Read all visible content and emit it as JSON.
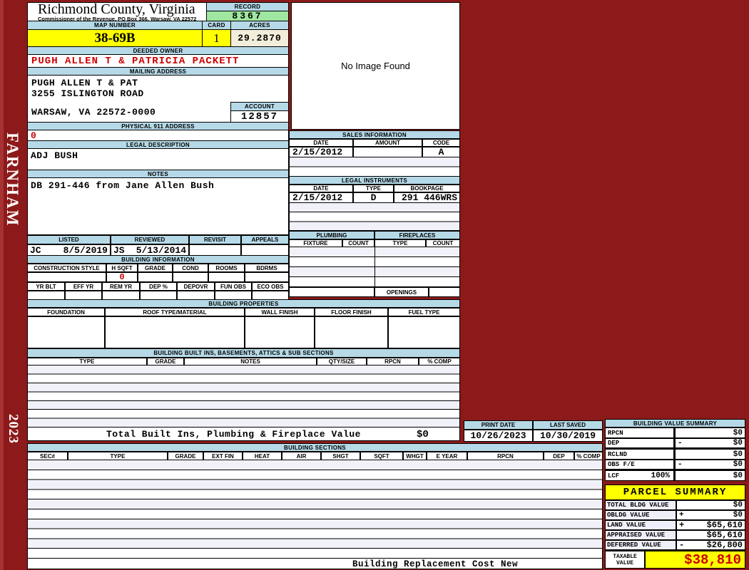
{
  "sidebar": {
    "district": "FARNHAM",
    "year": "2023"
  },
  "header": {
    "county_title": "Richmond County, Virginia",
    "county_subtitle": "Commissioner of the Revenue, PO Box 366, Warsaw, VA 22572",
    "record_label": "RECORD",
    "record_value": "8367",
    "map_label": "MAP NUMBER",
    "map_value": "38-69B",
    "card_label": "CARD",
    "card_value": "1",
    "acres_label": "ACRES",
    "acres_value": "29.2870"
  },
  "owner": {
    "label": "DEEDED OWNER",
    "value": "PUGH ALLEN T & PATRICIA PACKETT"
  },
  "mailing": {
    "label": "MAILING ADDRESS",
    "line1": "PUGH ALLEN T & PAT",
    "line2": "3255 ISLINGTON ROAD",
    "line3": "WARSAW, VA 22572-0000"
  },
  "account": {
    "label": "ACCOUNT",
    "value": "12857"
  },
  "physical_911": {
    "label": "PHYSICAL 911 ADDRESS",
    "value": "0"
  },
  "legal_description": {
    "label": "LEGAL DESCRIPTION",
    "value": "ADJ BUSH"
  },
  "notes": {
    "label": "NOTES",
    "value": "DB 291-446 from Jane Allen Bush"
  },
  "image_box": {
    "text": "No Image Found"
  },
  "review": {
    "listed_label": "LISTED",
    "reviewed_label": "REVIEWED",
    "revisit_label": "REVISIT",
    "appeals_label": "APPEALS",
    "listed_by": "JC",
    "listed_date": "8/5/2019",
    "reviewed_by": "JS",
    "reviewed_date": "5/13/2014"
  },
  "sales": {
    "title": "SALES INFORMATION",
    "col_date": "DATE",
    "col_amount": "AMOUNT",
    "col_code": "CODE",
    "row1": {
      "date": "2/15/2012",
      "amount": "",
      "code": "A"
    }
  },
  "instruments": {
    "title": "LEGAL INSTRUMENTS",
    "col_date": "DATE",
    "col_type": "TYPE",
    "col_bookpage": "BOOKPAGE",
    "row1": {
      "date": "2/15/2012",
      "type": "D",
      "bookpage": "291 446WRS"
    }
  },
  "plumbing": {
    "title": "PLUMBING",
    "col_fixture": "FIXTURE",
    "col_count": "COUNT"
  },
  "fireplaces": {
    "title": "FIREPLACES",
    "col_type": "TYPE",
    "col_count": "COUNT",
    "openings_label": "OPENINGS"
  },
  "building_info": {
    "title": "BUILDING INFORMATION",
    "cols1": [
      "CONSTRUCTION STYLE",
      "H SQFT",
      "GRADE",
      "COND",
      "ROOMS",
      "BDRMS"
    ],
    "h_sqft_value": "0",
    "cols2": [
      "YR BLT",
      "EFF YR",
      "REM YR",
      "DEP %",
      "DEPOVR",
      "FUN OBS",
      "ECO OBS"
    ]
  },
  "building_properties": {
    "title": "BUILDING PROPERTIES",
    "cols": [
      "FOUNDATION",
      "ROOF TYPE/MATERIAL",
      "WALL FINISH",
      "FLOOR FINISH",
      "FUEL TYPE"
    ]
  },
  "built_ins": {
    "title": "BUILDING BUILT INS, BASEMENTS, ATTICS & SUB SECTIONS",
    "cols": [
      "TYPE",
      "GRADE",
      "NOTES",
      "QTY/SIZE",
      "RPCN",
      "% COMP"
    ],
    "total_label": "Total Built Ins, Plumbing & Fireplace Value",
    "total_value": "$0"
  },
  "print_info": {
    "print_date_label": "PRINT DATE",
    "print_date": "10/26/2023",
    "last_saved_label": "LAST SAVED",
    "last_saved": "10/30/2019"
  },
  "building_value_summary": {
    "title": "BUILDING VALUE SUMMARY",
    "rows": [
      {
        "label": "RPCN",
        "pct": "",
        "sign": "",
        "value": "$0"
      },
      {
        "label": "DEP",
        "pct": "",
        "sign": "-",
        "value": "$0"
      },
      {
        "label": "RCLND",
        "pct": "",
        "sign": "",
        "value": "$0"
      },
      {
        "label": "OBS F/E",
        "pct": "",
        "sign": "-",
        "value": "$0"
      },
      {
        "label": "LCF",
        "pct": "100%",
        "sign": "",
        "value": "$0"
      }
    ]
  },
  "building_sections": {
    "title": "BUILDING SECTIONS",
    "cols": [
      "SEC#",
      "TYPE",
      "GRADE",
      "EXT FIN",
      "HEAT",
      "AIR",
      "SHGT",
      "SQFT",
      "WHGT",
      "E YEAR",
      "RPCN",
      "DEP",
      "% COMP"
    ],
    "footer": "Building Replacement Cost New"
  },
  "parcel_summary": {
    "title": "PARCEL SUMMARY",
    "rows": [
      {
        "label": "TOTAL BLDG VALUE",
        "sign": "",
        "value": "$0"
      },
      {
        "label": "OBLDG VALUE",
        "sign": "+",
        "value": "$0"
      },
      {
        "label": "LAND VALUE",
        "sign": "+",
        "value": "$65,610"
      },
      {
        "label": "APPRAISED VALUE",
        "sign": "",
        "value": "$65,610"
      },
      {
        "label": "DEFERRED VALUE",
        "sign": "-",
        "value": "$26,800"
      }
    ],
    "taxable_label_1": "TAXABLE",
    "taxable_label_2": "VALUE",
    "taxable_value": "$38,810"
  }
}
